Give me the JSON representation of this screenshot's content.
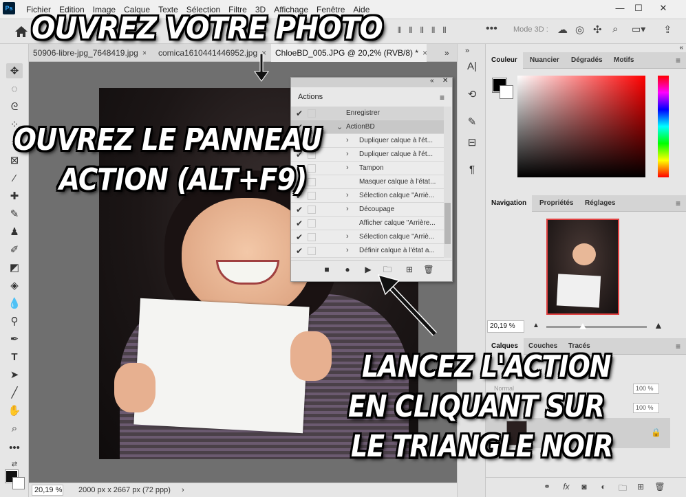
{
  "app": {
    "logo": "Ps"
  },
  "menubar": {
    "items": [
      "Fichier",
      "Edition",
      "Image",
      "Calque",
      "Texte",
      "Sélection",
      "Filtre",
      "3D",
      "Affichage",
      "Fenêtre",
      "Aide"
    ]
  },
  "optbar": {
    "mode3d": "Mode 3D :"
  },
  "tabs": [
    {
      "label": "50906-libre-jpg_7648419.jpg"
    },
    {
      "label": "comica1610441446952.jpg"
    },
    {
      "label": "ChloeBD_005.JPG @ 20,2% (RVB/8) *"
    }
  ],
  "status": {
    "zoom": "20,19 %",
    "docinfo": "2000 px x 2667 px (72 ppp)"
  },
  "actions_panel": {
    "tab": "Actions",
    "rows": [
      {
        "label": "Enregistrer"
      },
      {
        "label": "ActionBD"
      },
      {
        "label": "Dupliquer calque à l'ét..."
      },
      {
        "label": "Dupliquer calque à l'ét..."
      },
      {
        "label": "Tampon"
      },
      {
        "label": "Masquer calque à l'état..."
      },
      {
        "label": "Sélection calque \"Arriè..."
      },
      {
        "label": "Découpage"
      },
      {
        "label": "Afficher calque \"Arrière..."
      },
      {
        "label": "Sélection calque \"Arriè..."
      },
      {
        "label": "Définir calque à l'état a..."
      }
    ]
  },
  "color_panel": {
    "tabs": [
      "Couleur",
      "Nuancier",
      "Dégradés",
      "Motifs"
    ]
  },
  "nav_panel": {
    "tabs": [
      "Navigation",
      "Propriétés",
      "Réglages"
    ],
    "zoom": "20,19 %"
  },
  "layers_panel": {
    "tabs": [
      "Calques",
      "Couches",
      "Tracés"
    ],
    "blend": "Normal",
    "opacity": "100 %",
    "fill": "100 %"
  },
  "captions": {
    "open_photo": "OUVREZ VOTRE PHOTO",
    "open_panel_1": "OUVREZ LE PANNEAU",
    "open_panel_2": "ACTION (ALT+F9)",
    "run_1": "LANCEZ L'ACTION",
    "run_2": "EN CLIQUANT SUR",
    "run_3": "LE TRIANGLE NOIR"
  }
}
